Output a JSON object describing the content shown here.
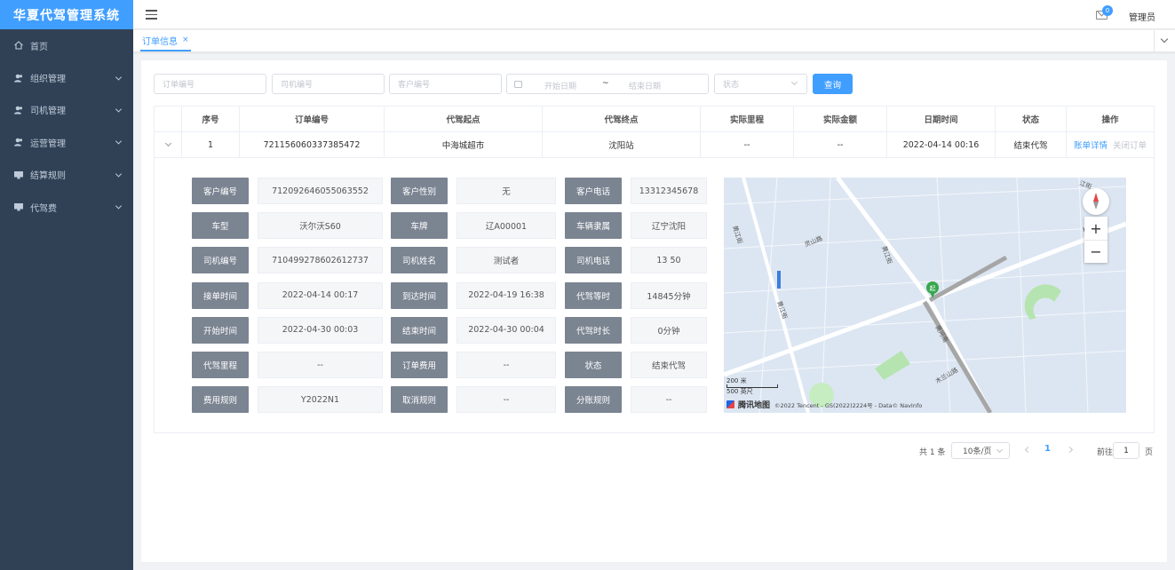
{
  "app": {
    "title": "华夏代驾管理系统"
  },
  "sidebar": {
    "items": [
      {
        "label": "首页",
        "icon": "home-icon",
        "has_children": false
      },
      {
        "label": "组织管理",
        "icon": "users-icon",
        "has_children": true
      },
      {
        "label": "司机管理",
        "icon": "users-icon",
        "has_children": true
      },
      {
        "label": "运营管理",
        "icon": "users-icon",
        "has_children": true
      },
      {
        "label": "结算规则",
        "icon": "monitor-icon",
        "has_children": true
      },
      {
        "label": "代驾费",
        "icon": "monitor-icon",
        "has_children": true
      }
    ]
  },
  "header": {
    "message_count": "0",
    "user": "管理员"
  },
  "tabs": [
    {
      "label": "订单信息",
      "close": "×"
    }
  ],
  "filters": {
    "order_no": "订单编号",
    "driver_no": "司机编号",
    "customer_no": "客户编号",
    "start_date": "开始日期",
    "range_sep": "~",
    "end_date": "结束日期",
    "status": "状态",
    "query_button": "查询"
  },
  "table": {
    "headers": [
      "",
      "序号",
      "订单编号",
      "代驾起点",
      "代驾终点",
      "实际里程",
      "实际金额",
      "日期时间",
      "状态",
      "操作"
    ],
    "rows": [
      [
        "",
        "1",
        "721156060337385472",
        "中海城超市",
        "沈阳站",
        "--",
        "--",
        "2022-04-14 00:16",
        "结束代驾"
      ]
    ],
    "actions": {
      "detail": "账单详情",
      "close": "关闭订单"
    }
  },
  "detail": [
    [
      {
        "label": "客户编号",
        "value": "712092646055063552"
      },
      {
        "label": "客户性别",
        "value": "无"
      },
      {
        "label": "客户电话",
        "value": "13312345678"
      }
    ],
    [
      {
        "label": "车型",
        "value": "沃尔沃S60"
      },
      {
        "label": "车牌",
        "value": "辽A00001"
      },
      {
        "label": "车辆隶属",
        "value": "辽宁沈阳"
      }
    ],
    [
      {
        "label": "司机编号",
        "value": "710499278602612737"
      },
      {
        "label": "司机姓名",
        "value": "测试者"
      },
      {
        "label": "司机电话",
        "value": "13        50"
      }
    ],
    [
      {
        "label": "接单时间",
        "value": "2022-04-14 00:17"
      },
      {
        "label": "到达时间",
        "value": "2022-04-19 16:38"
      },
      {
        "label": "代驾等时",
        "value": "14845分钟"
      }
    ],
    [
      {
        "label": "开始时间",
        "value": "2022-04-30 00:03"
      },
      {
        "label": "结束时间",
        "value": "2022-04-30 00:04"
      },
      {
        "label": "代驾时长",
        "value": "0分钟"
      }
    ],
    [
      {
        "label": "代驾里程",
        "value": "--"
      },
      {
        "label": "订单费用",
        "value": "--"
      },
      {
        "label": "状态",
        "value": "结束代驾"
      }
    ],
    [
      {
        "label": "费用规则",
        "value": "Y2022N1"
      },
      {
        "label": "取消规则",
        "value": "--"
      },
      {
        "label": "分账规则",
        "value": "--"
      }
    ]
  ],
  "map": {
    "roads": [
      "黄江街",
      "灵山路",
      "松山",
      "黄江街",
      "黄江街",
      "木兰山路",
      "黄河南",
      "江街"
    ],
    "marker": "起",
    "scale_m": "200 米",
    "scale_ft": "500 英尺",
    "logo": "腾讯地图",
    "copyright": "©2022 Tencent - GS(2022)2224号 - Data© NavInfo",
    "zoom_in": "+",
    "zoom_out": "−"
  },
  "pagination": {
    "total": "共 1 条",
    "page_size": "10条/页",
    "current": "1",
    "goto_prefix": "前往",
    "goto_value": "1",
    "goto_suffix": "页"
  }
}
